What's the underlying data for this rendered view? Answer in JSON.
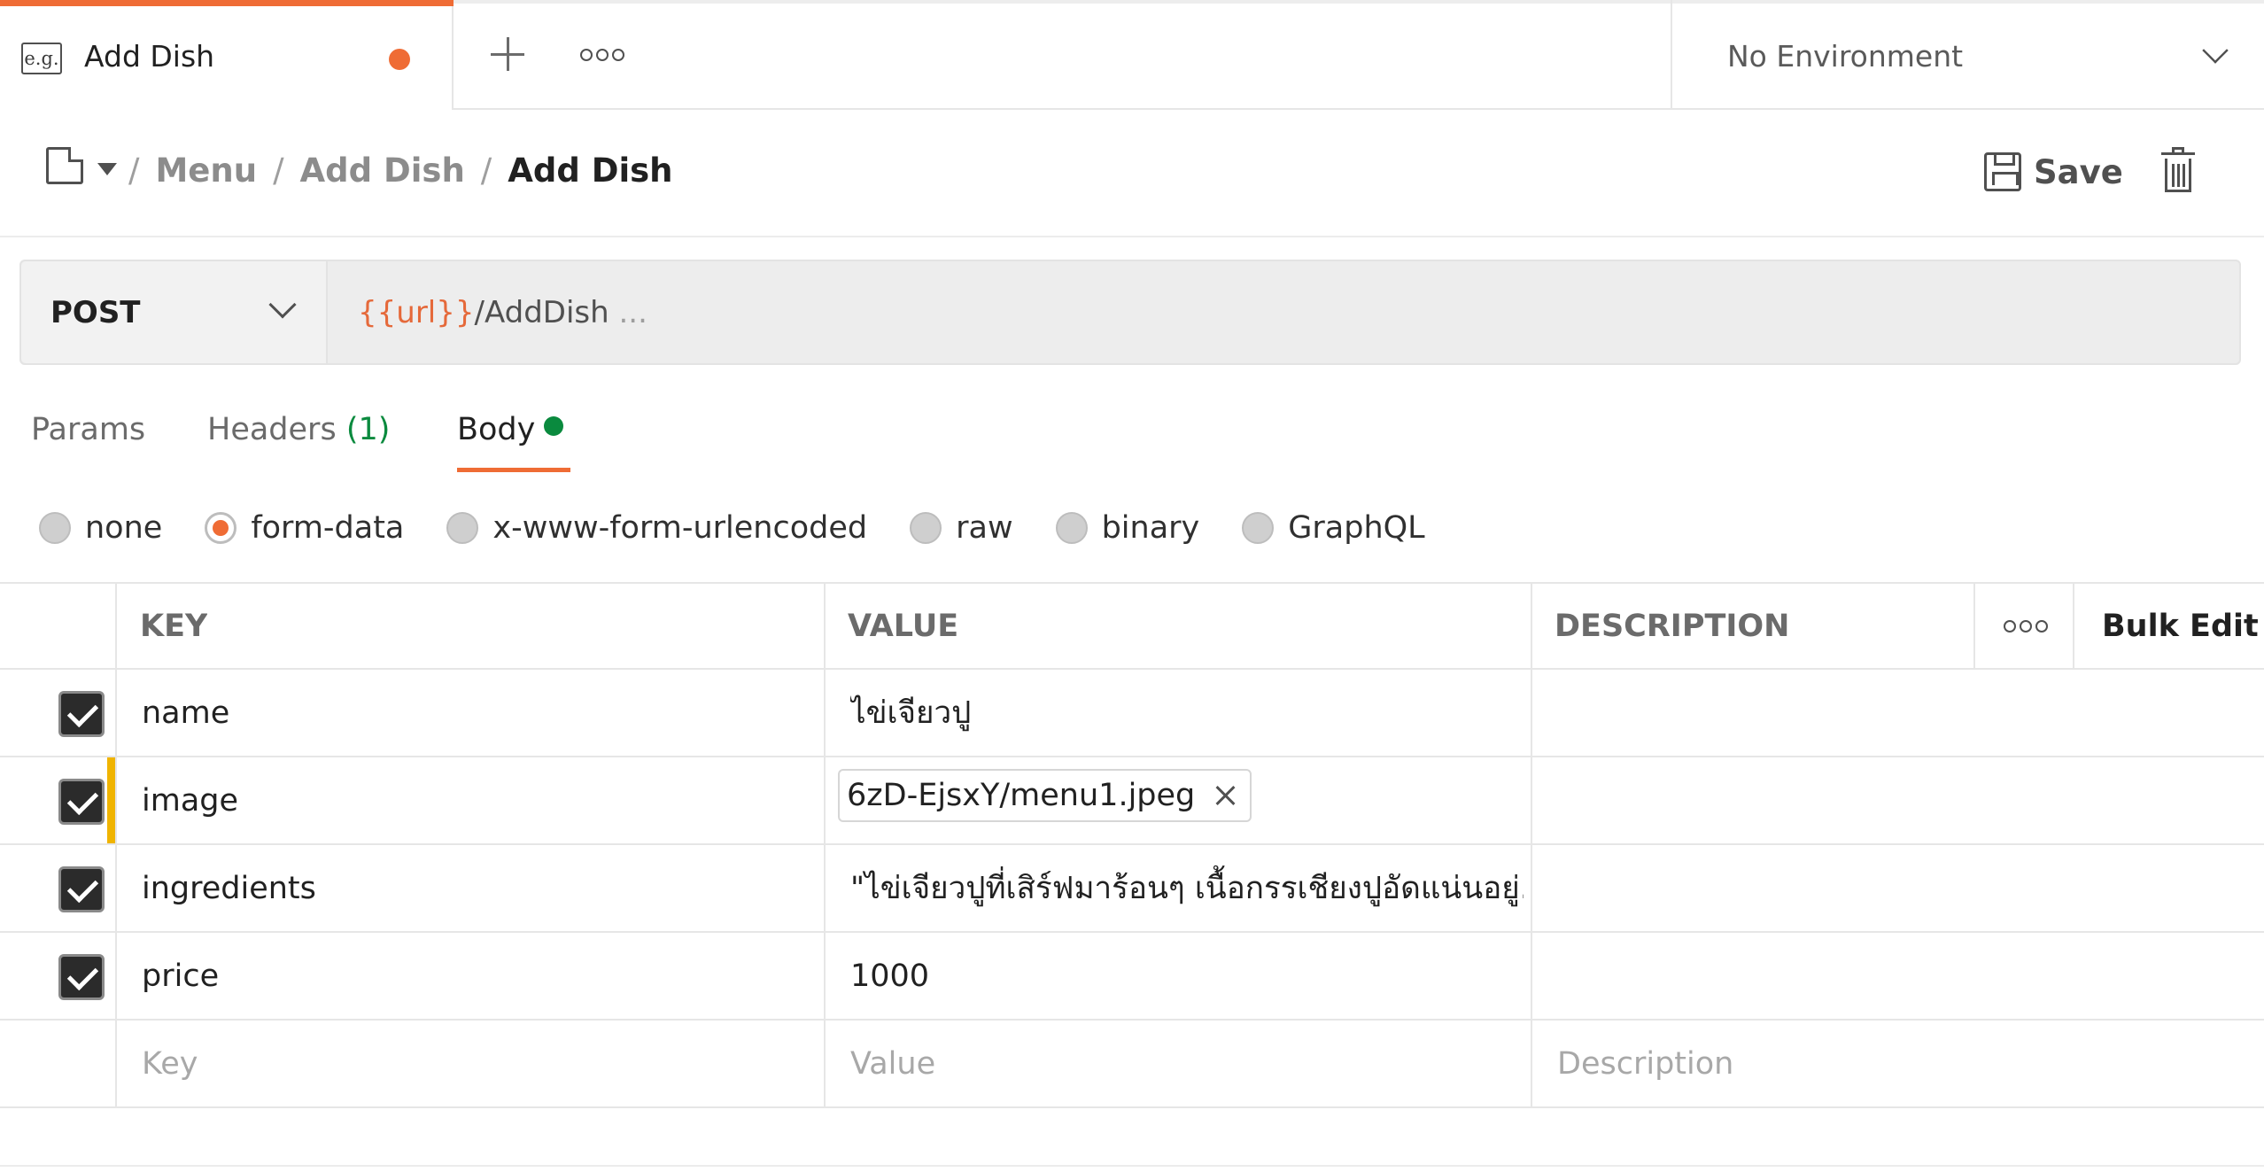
{
  "tabbar": {
    "tab_icon_label": "e.g.",
    "active_tab_title": "Add Dish",
    "environment": "No Environment"
  },
  "breadcrumb": {
    "items": [
      "Menu",
      "Add Dish"
    ],
    "current": "Add Dish",
    "separator": "/"
  },
  "actions": {
    "save_label": "Save"
  },
  "request": {
    "method": "POST",
    "url_variable": "{{url}}",
    "url_path": "/AddDish",
    "url_ellipsis": "..."
  },
  "request_tabs": {
    "params": "Params",
    "headers": "Headers",
    "headers_count": "(1)",
    "body": "Body"
  },
  "body_types": [
    {
      "label": "none",
      "checked": false
    },
    {
      "label": "form-data",
      "checked": true
    },
    {
      "label": "x-www-form-urlencoded",
      "checked": false
    },
    {
      "label": "raw",
      "checked": false
    },
    {
      "label": "binary",
      "checked": false
    },
    {
      "label": "GraphQL",
      "checked": false
    }
  ],
  "table": {
    "headers": {
      "key": "KEY",
      "value": "VALUE",
      "description": "DESCRIPTION",
      "bulk_edit": "Bulk Edit"
    },
    "rows": [
      {
        "key": "name",
        "value": "ไข่เจียวปู",
        "checked": true
      },
      {
        "key": "image",
        "value": "6zD-EjsxY/menu1.jpeg",
        "checked": true,
        "type": "file"
      },
      {
        "key": "ingredients",
        "value": "\"ไข่เจียวปูที่เสิร์ฟมาร้อนๆ เนื้อกรรเชียงปูอัดแน่นอยู่...",
        "checked": true
      },
      {
        "key": "price",
        "value": "1000",
        "checked": true
      }
    ],
    "placeholders": {
      "key": "Key",
      "value": "Value",
      "description": "Description"
    }
  },
  "colors": {
    "accent": "#ef6c35",
    "active_green": "#0a8a3e",
    "modified_marker": "#f0b400"
  }
}
